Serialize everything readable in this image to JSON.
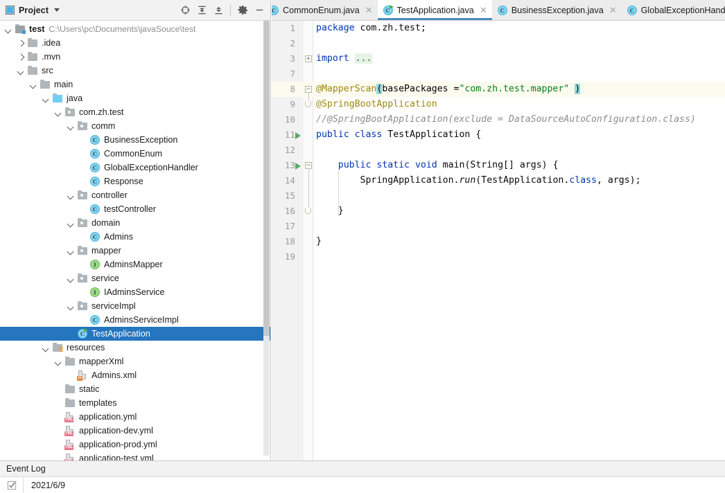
{
  "project_panel": {
    "title": "Project",
    "title_icon": "project-window-icon",
    "dropdown_icon": "chevron-down-icon",
    "toolbar_buttons": [
      {
        "name": "locate-in-tree-icon",
        "label": "Select Opened File"
      },
      {
        "name": "expand-all-icon",
        "label": "Expand All"
      },
      {
        "name": "collapse-all-icon",
        "label": "Collapse All"
      },
      {
        "name": "gear-icon",
        "label": "Settings"
      },
      {
        "name": "minimize-icon",
        "label": "Hide"
      }
    ],
    "tree": [
      {
        "label": "test",
        "path": "C:\\Users\\pc\\Documents\\javaSouce\\test",
        "depth": 0,
        "arrow": "down",
        "icon": "module-folder-icon",
        "bold": true
      },
      {
        "label": ".idea",
        "depth": 1,
        "arrow": "right",
        "icon": "folder-icon"
      },
      {
        "label": ".mvn",
        "depth": 1,
        "arrow": "right",
        "icon": "folder-icon"
      },
      {
        "label": "src",
        "depth": 1,
        "arrow": "down",
        "icon": "folder-icon"
      },
      {
        "label": "main",
        "depth": 2,
        "arrow": "down",
        "icon": "folder-icon"
      },
      {
        "label": "java",
        "depth": 3,
        "arrow": "down",
        "icon": "source-root-folder-icon"
      },
      {
        "label": "com.zh.test",
        "depth": 4,
        "arrow": "down",
        "icon": "package-icon"
      },
      {
        "label": "comm",
        "depth": 5,
        "arrow": "down",
        "icon": "package-icon"
      },
      {
        "label": "BusinessException",
        "depth": 6,
        "arrow": "none",
        "icon": "java-class-icon"
      },
      {
        "label": "CommonEnum",
        "depth": 6,
        "arrow": "none",
        "icon": "java-class-icon"
      },
      {
        "label": "GlobalExceptionHandler",
        "depth": 6,
        "arrow": "none",
        "icon": "java-class-icon"
      },
      {
        "label": "Response",
        "depth": 6,
        "arrow": "none",
        "icon": "java-class-icon"
      },
      {
        "label": "controller",
        "depth": 5,
        "arrow": "down",
        "icon": "package-icon"
      },
      {
        "label": "testController",
        "depth": 6,
        "arrow": "none",
        "icon": "java-class-icon"
      },
      {
        "label": "domain",
        "depth": 5,
        "arrow": "down",
        "icon": "package-icon"
      },
      {
        "label": "Admins",
        "depth": 6,
        "arrow": "none",
        "icon": "java-class-icon"
      },
      {
        "label": "mapper",
        "depth": 5,
        "arrow": "down",
        "icon": "package-icon"
      },
      {
        "label": "AdminsMapper",
        "depth": 6,
        "arrow": "none",
        "icon": "java-interface-icon"
      },
      {
        "label": "service",
        "depth": 5,
        "arrow": "down",
        "icon": "package-icon"
      },
      {
        "label": "IAdminsService",
        "depth": 6,
        "arrow": "none",
        "icon": "java-interface-icon"
      },
      {
        "label": "serviceImpl",
        "depth": 5,
        "arrow": "down",
        "icon": "package-icon"
      },
      {
        "label": "AdminsServiceImpl",
        "depth": 6,
        "arrow": "none",
        "icon": "java-class-icon"
      },
      {
        "label": "TestApplication",
        "depth": 5,
        "arrow": "none",
        "icon": "runnable-java-class-icon",
        "selected": true
      },
      {
        "label": "resources",
        "depth": 3,
        "arrow": "down",
        "icon": "resource-root-folder-icon"
      },
      {
        "label": "mapperXml",
        "depth": 4,
        "arrow": "down",
        "icon": "folder-icon"
      },
      {
        "label": "Admins.xml",
        "depth": 5,
        "arrow": "none",
        "icon": "xml-file-icon"
      },
      {
        "label": "static",
        "depth": 4,
        "arrow": "none",
        "icon": "folder-icon"
      },
      {
        "label": "templates",
        "depth": 4,
        "arrow": "none",
        "icon": "folder-icon"
      },
      {
        "label": "application.yml",
        "depth": 4,
        "arrow": "none",
        "icon": "yml-file-icon"
      },
      {
        "label": "application-dev.yml",
        "depth": 4,
        "arrow": "none",
        "icon": "yml-file-icon"
      },
      {
        "label": "application-prod.yml",
        "depth": 4,
        "arrow": "none",
        "icon": "yml-file-icon"
      },
      {
        "label": "application-test.yml",
        "depth": 4,
        "arrow": "none",
        "icon": "yml-file-icon"
      }
    ]
  },
  "editor": {
    "tabs": [
      {
        "label": "CommonEnum.java",
        "icon": "java-class-icon",
        "active": false,
        "clipped": true
      },
      {
        "label": "TestApplication.java",
        "icon": "runnable-java-class-icon",
        "active": true
      },
      {
        "label": "BusinessException.java",
        "icon": "java-class-icon",
        "active": false
      },
      {
        "label": "GlobalExceptionHandler.j",
        "icon": "java-class-icon",
        "active": false,
        "clipped": true
      }
    ],
    "lines": [
      {
        "num": "1",
        "text": "package com.zh.test;"
      },
      {
        "num": "2",
        "text": ""
      },
      {
        "num": "3",
        "text": "import ..."
      },
      {
        "num": "7",
        "text": ""
      },
      {
        "num": "8",
        "text": "@MapperScan(basePackages =\"com.zh.test.mapper\" )",
        "current": true
      },
      {
        "num": "9",
        "text": "@SpringBootApplication"
      },
      {
        "num": "10",
        "text": "//@SpringBootApplication(exclude = DataSourceAutoConfiguration.class)"
      },
      {
        "num": "11",
        "text": "public class TestApplication {",
        "runnable": true
      },
      {
        "num": "12",
        "text": ""
      },
      {
        "num": "13",
        "text": "    public static void main(String[] args) {",
        "runnable": true
      },
      {
        "num": "14",
        "text": "        SpringApplication.run(TestApplication.class, args);"
      },
      {
        "num": "15",
        "text": ""
      },
      {
        "num": "16",
        "text": "    }"
      },
      {
        "num": "17",
        "text": ""
      },
      {
        "num": "18",
        "text": "}"
      },
      {
        "num": "19",
        "text": ""
      }
    ]
  },
  "bottom": {
    "event_log_label": "Event Log",
    "status_icon": "checkbox-icon",
    "status_text": "2021/6/9"
  },
  "colors": {
    "selection_blue": "#2675bf",
    "tab_underline": "#4a8ec2",
    "keyword": "#0033b3",
    "string": "#067d17",
    "annotation": "#9e880d",
    "comment": "#8c8c8c",
    "run_green": "#59a869",
    "current_line": "#fcfbef",
    "bracket_match": "#93d9d9"
  }
}
